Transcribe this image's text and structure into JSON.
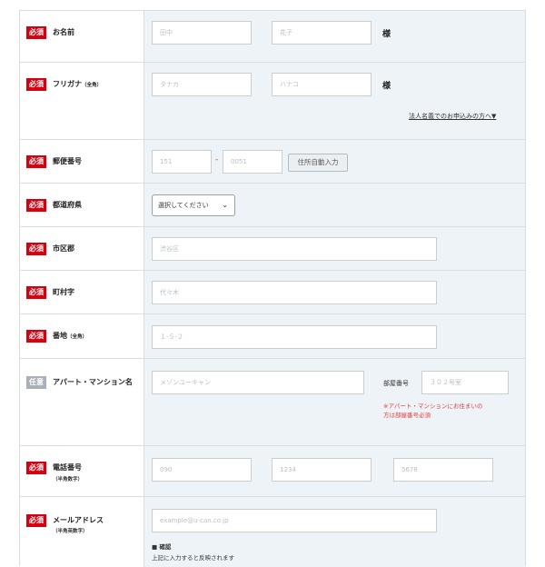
{
  "badges": {
    "required": "必須",
    "optional": "任意"
  },
  "rows": {
    "name": {
      "label": "お名前",
      "last_ph": "田中",
      "first_ph": "花子",
      "suffix": "様"
    },
    "kana": {
      "label": "フリガナ",
      "label_note": "（全角）",
      "last_ph": "タナカ",
      "first_ph": "ハナコ",
      "suffix": "様",
      "corp_link": "法人名義でのお申込みの方へ▼"
    },
    "zip": {
      "label": "郵便番号",
      "zip1_ph": "151",
      "sep": "-",
      "zip2_ph": "0051",
      "auto_button": "住所自動入力"
    },
    "pref": {
      "label": "都道府県",
      "select_value": "選択してください"
    },
    "city": {
      "label": "市区郡",
      "ph": "渋谷区"
    },
    "town": {
      "label": "町村字",
      "ph": "代々木"
    },
    "banchi": {
      "label": "番地",
      "label_note": "（全角）",
      "ph": "１-５-２"
    },
    "apt": {
      "label": "アパート・マンション名",
      "ph": "メゾンユーキャン",
      "room_label": "部屋番号",
      "room_ph": "３０２号室",
      "note_line1": "※アパート・マンションにお住まいの",
      "note_line2": "方は部屋番号必須"
    },
    "tel": {
      "label": "電話番号",
      "sub": "（半角数字）",
      "tel1_ph": "090",
      "tel2_ph": "1234",
      "tel3_ph": "5678"
    },
    "email": {
      "label": "メールアドレス",
      "sub": "（半角英数字）",
      "ph": "example@u-can.co.jp",
      "confirm_title": "■ 確認",
      "confirm_text": "上記に入力すると反映されます"
    }
  },
  "colors": {
    "required": "#d7000f",
    "optional": "#a8b0b8",
    "field_bg": "#eef3f8",
    "note": "#e0413a"
  }
}
